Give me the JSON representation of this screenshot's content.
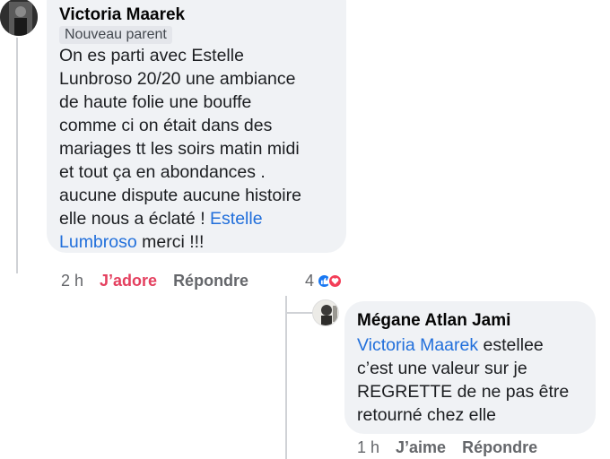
{
  "comment": {
    "author": "Victoria Maarek",
    "badge": "Nouveau parent",
    "lines": [
      "On es parti avec Estelle",
      "Lunbroso 20/20 une ambiance",
      "de haute folie une bouffe",
      "comme ci on était dans des",
      "mariages tt les soirs matin midi",
      "et tout ça en abondances .",
      "aucune dispute aucune histoire",
      "elle nous a éclaté ! "
    ],
    "mention_part1": "Estelle",
    "mention_part2": "Lumbroso",
    "tail": " merci !!!",
    "time": "2 h",
    "love_label": "J’adore",
    "reply_label": "Répondre",
    "reaction_count": "4",
    "reaction_icons": [
      "like-icon",
      "love-icon"
    ]
  },
  "reply": {
    "author": "Mégane Atlan Jami",
    "mention": "Victoria Maarek",
    "line1_rest": " estellee",
    "lines": [
      "c’est une valeur sur je",
      "REGRETTE de ne pas être",
      "retourné chez elle"
    ],
    "time": "1 h",
    "like_label": "J’aime",
    "reply_label": "Répondre"
  },
  "colors": {
    "bubble": "#f0f2f5",
    "mention": "#216fdb",
    "love": "#e4405f",
    "like_reaction": "#1877f2",
    "love_reaction": "#f33e58"
  }
}
